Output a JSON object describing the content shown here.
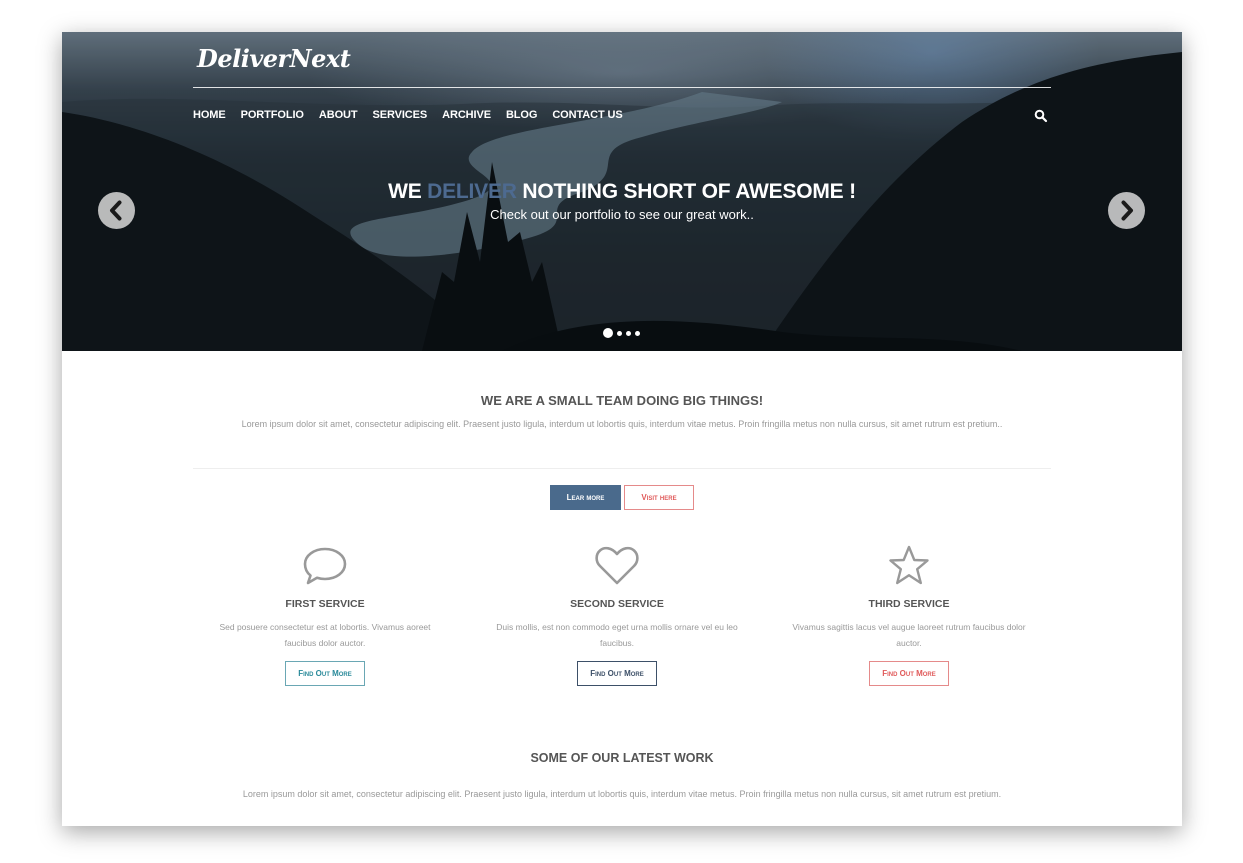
{
  "brand": {
    "logo": "DeliverNext"
  },
  "nav": {
    "items": [
      "HOME",
      "PORTFOLIO",
      "ABOUT",
      "SERVICES",
      "ARCHIVE",
      "BLOG",
      "CONTACT US"
    ],
    "search_icon": "search-icon"
  },
  "hero": {
    "title_before": "WE ",
    "title_accent": "DELIVER",
    "title_after": " NOTHING SHORT OF AWESOME !",
    "subtitle": "Check out our portfolio to see our great work..",
    "accent_color": "#4d6a90",
    "prev_icon": "chevron-left-icon",
    "next_icon": "chevron-right-icon",
    "slides": 4,
    "active_slide": 1
  },
  "intro": {
    "title": "WE ARE A SMALL TEAM DOING BIG THINGS!",
    "text": "Lorem ipsum dolor sit amet, consectetur adipiscing elit. Praesent justo ligula, interdum ut lobortis quis, interdum vitae metus. Proin fringilla metus non nulla cursus, sit amet rutrum est pretium..",
    "learn_button": "Lear more",
    "visit_button": "Visit here",
    "learn_color": "#4a6a8c",
    "visit_color": "#e05a5a"
  },
  "services": [
    {
      "icon": "speech-bubble-icon",
      "title": "FIRST SERVICE",
      "text": "Sed posuere consectetur est at lobortis. Vivamus aoreet faucibus dolor auctor.",
      "button": "Find Out More",
      "button_color": "#2a8a9a"
    },
    {
      "icon": "heart-icon",
      "title": "SECOND SERVICE",
      "text": "Duis mollis, est non commodo eget urna mollis ornare vel eu leo faucibus.",
      "button": "Find Out More",
      "button_color": "#3d5068"
    },
    {
      "icon": "star-icon",
      "title": "THIRD SERVICE",
      "text": "Vivamus sagittis lacus vel augue laoreet rutrum faucibus dolor auctor.",
      "button": "Find Out More",
      "button_color": "#e05a5a"
    }
  ],
  "latest": {
    "title": "SOME OF OUR LATEST WORK",
    "text": "Lorem ipsum dolor sit amet, consectetur adipiscing elit. Praesent justo ligula, interdum ut lobortis quis, interdum vitae metus. Proin fringilla metus non nulla cursus, sit amet rutrum est pretium."
  }
}
